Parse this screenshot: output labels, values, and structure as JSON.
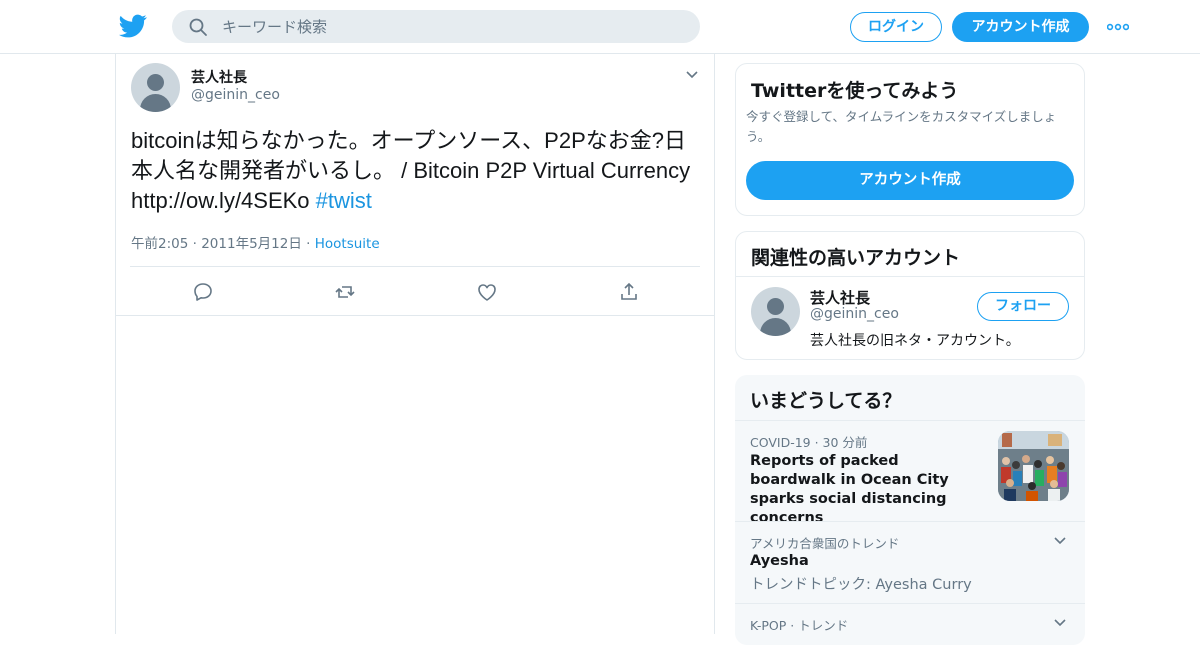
{
  "colors": {
    "accent": "#1da1f2",
    "link": "#1b95e0",
    "muted": "#657786",
    "text": "#14171a"
  },
  "header": {
    "logo_icon": "twitter-bird-icon",
    "search_placeholder": "キーワード検索",
    "login_label": "ログイン",
    "signup_label": "アカウント作成",
    "more_icon": "more-dots-icon"
  },
  "tweet": {
    "name": "芸人社長",
    "handle": "@geinin_ceo",
    "text_main": "bitcoinは知らなかった。オープンソース、P2Pなお金?日本人名な開発者がいるし。 /  Bitcoin P2P Virtual Currency http://ow.ly/4SEKo ",
    "hashtag": "#twist",
    "time": "午前2:05",
    "date": "2011年5月12日",
    "separator": "·",
    "source": "Hootsuite",
    "actions": [
      "reply-icon",
      "retweet-icon",
      "like-icon",
      "share-icon"
    ]
  },
  "signup_card": {
    "title": "Twitterを使ってみよう",
    "description": "今すぐ登録して、タイムラインをカスタマイズしましょう。",
    "button_label": "アカウント作成"
  },
  "related_card": {
    "title": "関連性の高いアカウント",
    "account": {
      "name": "芸人社長",
      "handle": "@geinin_ceo",
      "bio": "芸人社長の旧ネタ・アカウント。",
      "follow_label": "フォロー"
    }
  },
  "trends_card": {
    "title": "いまどうしてる？",
    "items": [
      {
        "meta": "COVID-19 · 30 分前",
        "headline": "Reports of packed boardwalk in Ocean City sparks social distancing concerns"
      },
      {
        "meta": "アメリカ合衆国のトレンド",
        "headline": "Ayesha",
        "sub": "トレンドトピック: Ayesha Curry"
      },
      {
        "meta": "K-POP · トレンド"
      }
    ]
  }
}
